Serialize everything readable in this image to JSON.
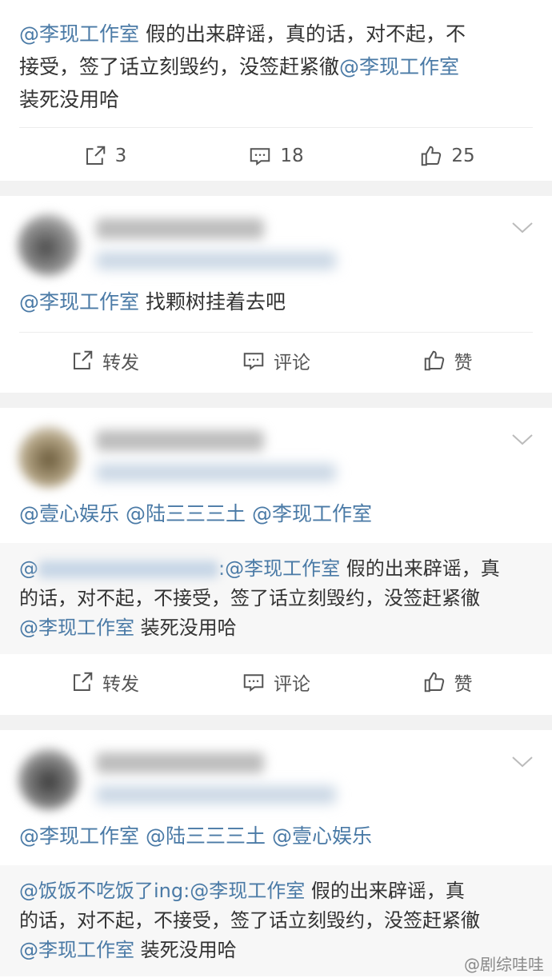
{
  "post1": {
    "line1_mention": "@李现工作室",
    "line1_text": " 假的出来辟谣，真的话，对不起，不",
    "line2_text": "接受，签了话立刻毁约，没签赶紧徹",
    "line2_mention": "@李现工作室",
    "line3_text": "装死没用哈",
    "repost_count": "3",
    "comment_count": "18",
    "like_count": "25"
  },
  "post2": {
    "mention": "@李现工作室",
    "text": " 找颗树挂着去吧",
    "repost_label": "转发",
    "comment_label": "评论",
    "like_label": "赞"
  },
  "post3": {
    "mention1": "@壹心娱乐",
    "mention2": "@陆三三三土",
    "mention3": "@李现工作室",
    "repost_line1_mention": ":@李现工作室",
    "repost_line1_text": " 假的出来辟谣，真",
    "repost_line2_text": "的话，对不起，不接受，签了话立刻毁约，没签赶紧徹",
    "repost_line3_mention": "@李现工作室",
    "repost_line3_text": " 装死没用哈",
    "repost_label": "转发",
    "comment_label": "评论",
    "like_label": "赞"
  },
  "post4": {
    "mention1": "@李现工作室",
    "mention2": "@陆三三三土",
    "mention3": "@壹心娱乐",
    "repost_user": "@饭饭不吃饭了ing",
    "repost_line1_mention": ":@李现工作室",
    "repost_line1_text": " 假的出来辟谣，真",
    "repost_line2_text": "的话，对不起，不接受，签了话立刻毁约，没签赶紧徹",
    "repost_line3_mention": "@李现工作室",
    "repost_line3_text": " 装死没用哈"
  },
  "watermark": "@剧综哇哇"
}
